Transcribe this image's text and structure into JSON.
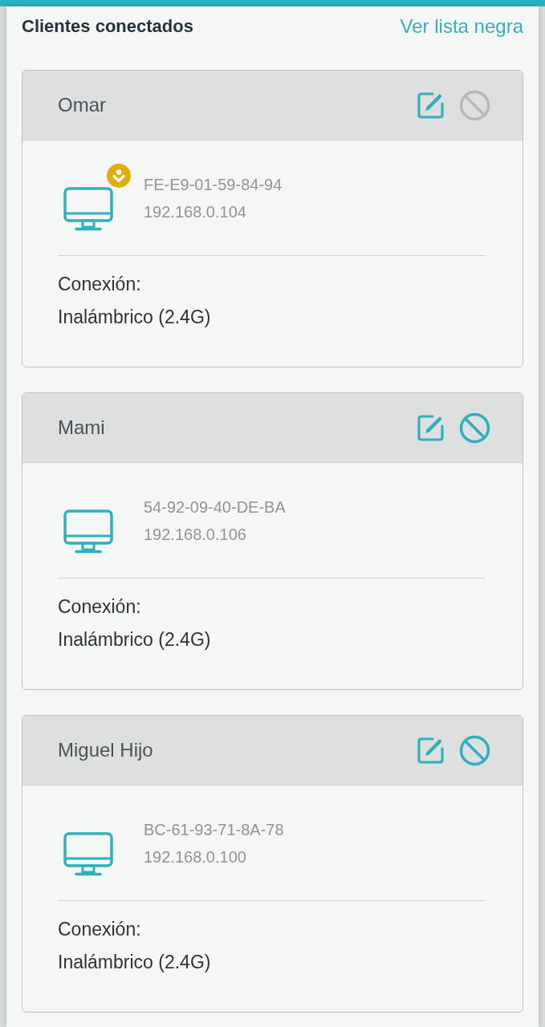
{
  "header": {
    "title": "Clientes conectados",
    "link": "Ver lista negra"
  },
  "clients": [
    {
      "name": "Omar",
      "badge": true,
      "block_disabled": true,
      "mac": "FE-E9-01-59-84-94",
      "ip": "192.168.0.104",
      "connection_label": "Conexión:",
      "connection": "Inalámbrico (2.4G)"
    },
    {
      "name": "Mami",
      "badge": false,
      "block_disabled": false,
      "mac": "54-92-09-40-DE-BA",
      "ip": "192.168.0.106",
      "connection_label": "Conexión:",
      "connection": "Inalámbrico (2.4G)"
    },
    {
      "name": "Miguel Hijo",
      "badge": false,
      "block_disabled": false,
      "mac": "BC-61-93-71-8A-78",
      "ip": "192.168.0.100",
      "connection_label": "Conexión:",
      "connection": "Inalámbrico (2.4G)"
    }
  ]
}
